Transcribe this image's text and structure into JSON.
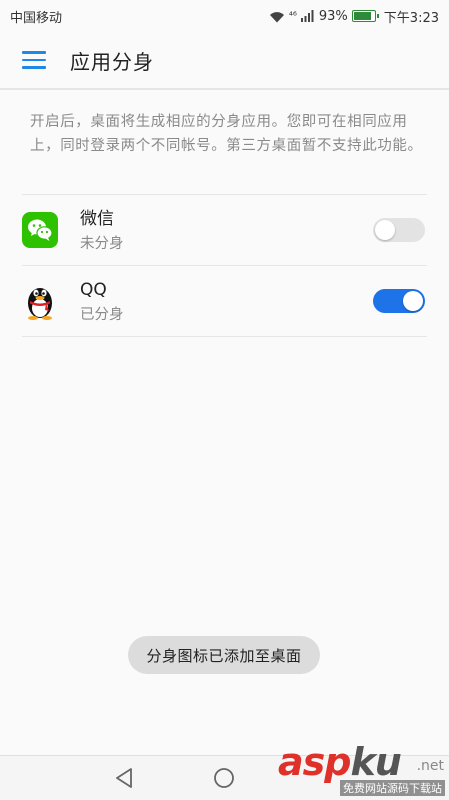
{
  "status_bar": {
    "carrier": "中国移动",
    "network": "⁴⁶",
    "battery_percent": "93%",
    "battery_level": 0.93,
    "time": "下午3:23"
  },
  "app_bar": {
    "title": "应用分身",
    "menu_icon": "hamburger-menu-icon"
  },
  "description": "开启后，桌面将生成相应的分身应用。您即可在相同应用上，同时登录两个不同帐号。第三方桌面暂不支持此功能。",
  "apps": [
    {
      "name": "微信",
      "status": "未分身",
      "icon": "wechat-icon",
      "enabled": false
    },
    {
      "name": "QQ",
      "status": "已分身",
      "icon": "qq-penguin-icon",
      "enabled": true
    }
  ],
  "toast": "分身图标已添加至桌面",
  "nav_bar": {
    "back_icon": "back-triangle-icon",
    "home_icon": "home-circle-icon"
  },
  "watermark": {
    "brand_a": "asp",
    "brand_b": "ku",
    "domain": ".net",
    "tagline": "免费网站源码下载站"
  },
  "colors": {
    "accent": "#1e73e8",
    "wechat_green": "#2dc100",
    "toggle_off": "#e3e3e3",
    "secondary_text": "#8a8a8a",
    "watermark_red": "#e0302a"
  }
}
